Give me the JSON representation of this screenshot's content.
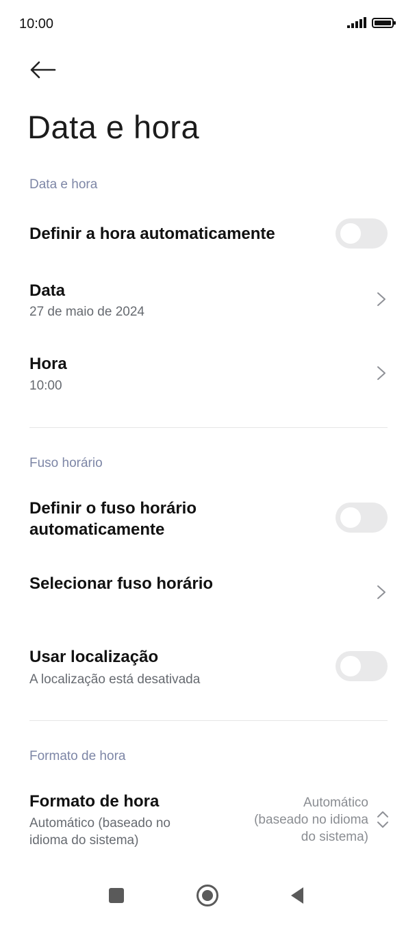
{
  "status_bar": {
    "time": "10:00"
  },
  "page": {
    "title": "Data e hora"
  },
  "sections": {
    "date_time": {
      "label": "Data e hora",
      "auto_time": {
        "title": "Definir a hora automaticamente",
        "enabled": false
      },
      "date": {
        "title": "Data",
        "value": "27 de maio de 2024"
      },
      "time": {
        "title": "Hora",
        "value": "10:00"
      }
    },
    "timezone": {
      "label": "Fuso horário",
      "auto_timezone": {
        "title_line1": "Definir o fuso horário",
        "title_line2": "automaticamente",
        "enabled": false
      },
      "select_timezone": {
        "title": "Selecionar fuso horário"
      },
      "use_location": {
        "title": "Usar localização",
        "subtitle": "A localização está desativada",
        "enabled": false
      }
    },
    "time_format": {
      "label": "Formato de hora",
      "format": {
        "title": "Formato de hora",
        "subtitle_line1": "Automático (baseado no",
        "subtitle_line2": "idioma do sistema)",
        "value_line1": "Automático",
        "value_line2": "(baseado no idioma",
        "value_line3": "do sistema)"
      }
    }
  },
  "icons": {
    "back": "arrow-left-icon",
    "chevron": "chevron-right-icon",
    "updown": "chevron-up-down-icon",
    "recents": "square-icon",
    "home": "circle-icon",
    "back_nav": "triangle-left-icon"
  }
}
